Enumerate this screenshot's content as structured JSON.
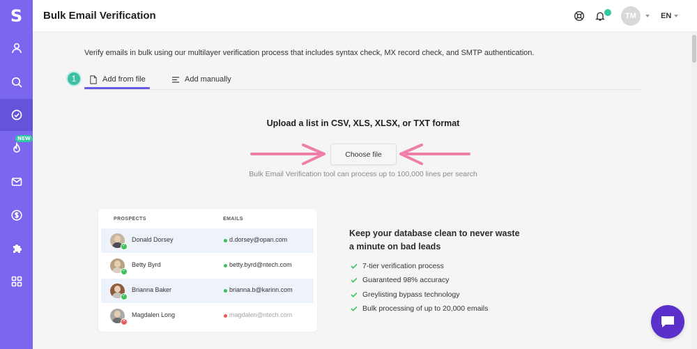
{
  "app": {
    "logo": "S"
  },
  "header": {
    "title": "Bulk Email Verification",
    "avatar_initials": "TM",
    "language": "EN"
  },
  "sidebar": {
    "items": [
      {
        "name": "user-icon",
        "active": false
      },
      {
        "name": "search-icon",
        "active": false
      },
      {
        "name": "verify-icon",
        "active": true
      },
      {
        "name": "warmup-icon",
        "active": false,
        "badge": "NEW"
      },
      {
        "name": "mail-icon",
        "active": false
      },
      {
        "name": "dollar-icon",
        "active": false
      },
      {
        "name": "puzzle-icon",
        "active": false
      },
      {
        "name": "apps-icon",
        "active": false
      }
    ]
  },
  "main": {
    "intro": "Verify emails in bulk using our multilayer verification process that includes syntax check, MX record check, and SMTP authentication.",
    "step_number": "1",
    "tabs": [
      {
        "label": "Add from file",
        "active": true
      },
      {
        "label": "Add manually",
        "active": false
      }
    ],
    "upload_title": "Upload a list in CSV, XLS, XLSX, or TXT format",
    "choose_file_label": "Choose file",
    "upload_note": "Bulk Email Verification tool can process up to 100,000 lines per search"
  },
  "prospects": {
    "headers": {
      "prospects": "PROSPECTS",
      "emails": "EMAILS"
    },
    "rows": [
      {
        "name": "Donald Dorsey",
        "email": "d.dorsey@opan.com",
        "valid": true
      },
      {
        "name": "Betty Byrd",
        "email": "betty.byrd@ntech.com",
        "valid": true
      },
      {
        "name": "Brianna Baker",
        "email": "brianna.b@karinn.com",
        "valid": true
      },
      {
        "name": "Magdalen Long",
        "email": "magdalen@ntech.com",
        "valid": false
      }
    ]
  },
  "benefits": {
    "title": "Keep your database clean to never waste a minute on bad leads",
    "items": [
      "7-tier verification process",
      "Guaranteed 98% accuracy",
      "Greylisting bypass technology",
      "Bulk processing of up to 20,000 emails"
    ]
  },
  "colors": {
    "sidebar": "#7b66f0",
    "sidebar_active": "#6553dc",
    "accent": "#6b5ae6",
    "teal": "#3dbfa4",
    "success": "#3ec05a",
    "error": "#e65b5b",
    "arrow": "#ee7fa8",
    "chat": "#5b2fc9"
  }
}
